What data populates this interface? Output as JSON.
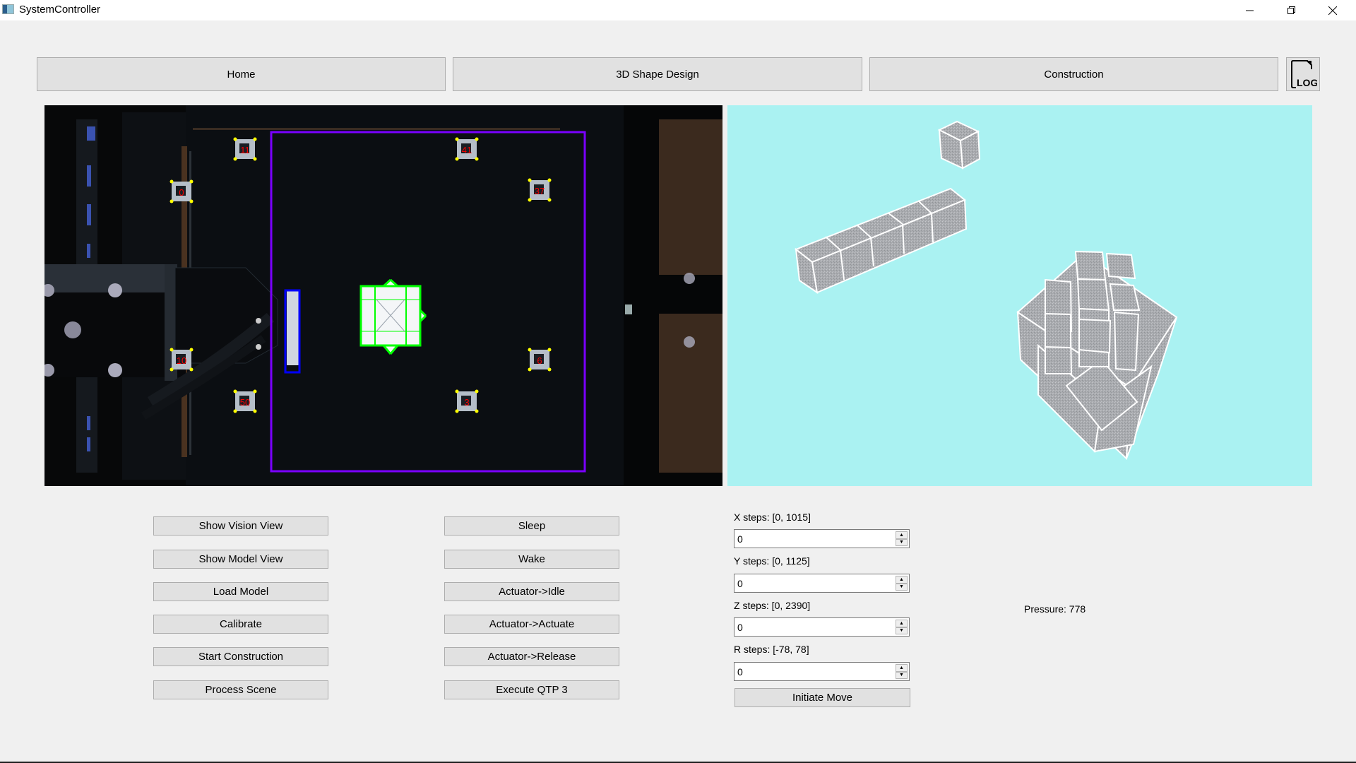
{
  "window": {
    "title": "SystemController",
    "controls": {
      "minimize": "minimize",
      "maximize": "restore",
      "close": "close"
    }
  },
  "nav": {
    "home": "Home",
    "shape_design": "3D Shape Design",
    "construction": "Construction",
    "log_icon_text": "LOG"
  },
  "vision_view": {
    "markers": [
      {
        "id": "11"
      },
      {
        "id": "41"
      },
      {
        "id": "0"
      },
      {
        "id": "37"
      },
      {
        "id": "10"
      },
      {
        "id": "6"
      },
      {
        "id": "50"
      },
      {
        "id": "3"
      }
    ],
    "colors": {
      "workspace_boundary": "#7a00ff",
      "detected_block": "#00ff00",
      "gripper_block": "#0000ff",
      "marker_label": "#ff0000",
      "marker_corner": "#ffff00"
    }
  },
  "model_view": {
    "background": "#aaf2f2",
    "cube_color": "#a6a6a8"
  },
  "left_buttons": [
    "Show Vision View",
    "Show Model View",
    "Load Model",
    "Calibrate",
    "Start Construction",
    "Process Scene"
  ],
  "mid_buttons": [
    "Sleep",
    "Wake",
    "Actuator->Idle",
    "Actuator->Actuate",
    "Actuator->Release",
    "Execute QTP 3"
  ],
  "steps": [
    {
      "label": "X steps: [0, 1015]",
      "value": "0"
    },
    {
      "label": "Y steps: [0, 1125]",
      "value": "0"
    },
    {
      "label": "Z steps: [0, 2390]",
      "value": "0"
    },
    {
      "label": "R steps: [-78, 78]",
      "value": "0"
    }
  ],
  "initiate_move": "Initiate Move",
  "pressure": "Pressure: 778"
}
